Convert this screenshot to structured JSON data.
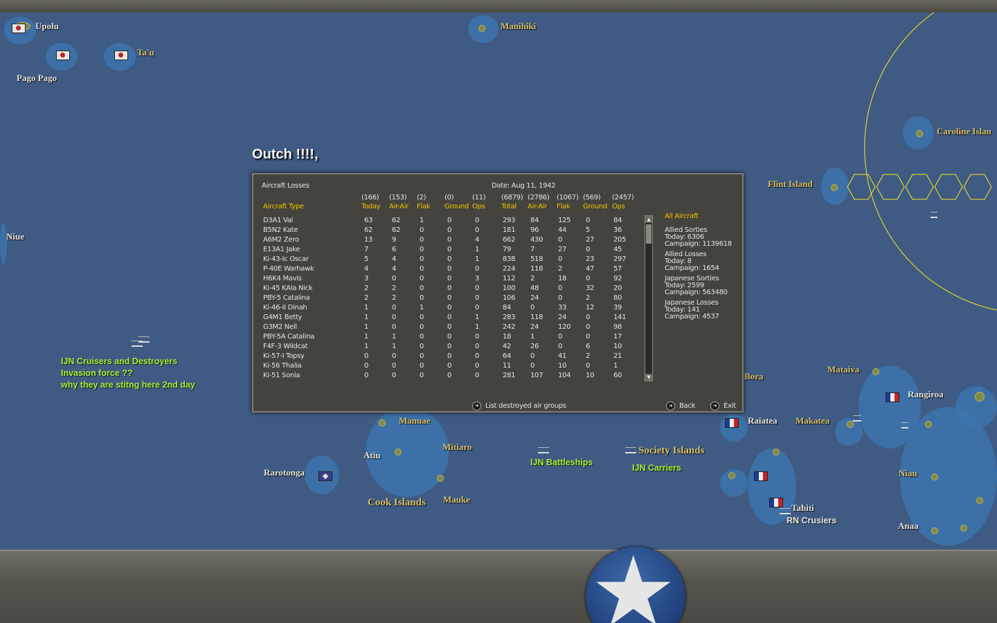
{
  "map": {
    "labels": {
      "upolu": "Upolu",
      "tau": "Ta'u",
      "pago_pago": "Pago Pago",
      "manihiki": "Manihiki",
      "caroline": "Caroline Islan",
      "flint": "Flint Island",
      "niue": "Niue",
      "bora": "Bora",
      "mataiva": "Mataiva",
      "rangiroa": "Rangiroa",
      "manuae": "Manuae",
      "raiatea": "Raiatea",
      "makatea": "Makatea",
      "mitiaro": "Mitiaro",
      "atiu": "Atiu",
      "society": "Society Islands",
      "niau": "Niau",
      "rarotonga": "Rarotonga",
      "cook": "Cook Islands",
      "mauke": "Mauke",
      "tahiti": "Tahiti",
      "anaa": "Anaa"
    },
    "annotations": {
      "cruisers_line1": "IJN Cruisers and Destroyers",
      "cruisers_line2": "Invasion force ??",
      "cruisers_line3": "why they are stitng here 2nd day",
      "battleships": "IJN Battleships",
      "carriers": "IJN Carriers",
      "rn_cruisers": "RN Crusiers"
    }
  },
  "title_text": "Outch !!!!,",
  "dialog": {
    "title": "Aircraft Losses",
    "date": "Date: Aug 11, 1942",
    "columns": [
      {
        "total": "",
        "label": "Aircraft Type"
      },
      {
        "total": "(166)",
        "label": "Today"
      },
      {
        "total": "(153)",
        "label": "Air-Air"
      },
      {
        "total": "(2)",
        "label": "Flak"
      },
      {
        "total": "(0)",
        "label": "Ground"
      },
      {
        "total": "(11)",
        "label": "Ops"
      },
      {
        "total": "(6879)",
        "label": "Total"
      },
      {
        "total": "(2786)",
        "label": "Air-Air"
      },
      {
        "total": "(1067)",
        "label": "Flak"
      },
      {
        "total": "(569)",
        "label": "Ground"
      },
      {
        "total": "(2457)",
        "label": "Ops"
      }
    ],
    "rows": [
      [
        "D3A1 Val",
        "63",
        "62",
        "1",
        "0",
        "0",
        "293",
        "84",
        "125",
        "0",
        "84"
      ],
      [
        "B5N2 Kate",
        "62",
        "62",
        "0",
        "0",
        "0",
        "181",
        "96",
        "44",
        "5",
        "36"
      ],
      [
        "A6M2 Zero",
        "13",
        "9",
        "0",
        "0",
        "4",
        "662",
        "430",
        "0",
        "27",
        "205"
      ],
      [
        "E13A1 Jake",
        "7",
        "6",
        "0",
        "0",
        "1",
        "79",
        "7",
        "27",
        "0",
        "45"
      ],
      [
        "Ki-43-Ic Oscar",
        "5",
        "4",
        "0",
        "0",
        "1",
        "838",
        "518",
        "0",
        "23",
        "297"
      ],
      [
        "P-40E Warhawk",
        "4",
        "4",
        "0",
        "0",
        "0",
        "224",
        "118",
        "2",
        "47",
        "57"
      ],
      [
        "H6K4 Mavis",
        "3",
        "0",
        "0",
        "0",
        "3",
        "112",
        "2",
        "18",
        "0",
        "92"
      ],
      [
        "Ki-45 KAIa Nick",
        "2",
        "2",
        "0",
        "0",
        "0",
        "100",
        "48",
        "0",
        "32",
        "20"
      ],
      [
        "PBY-5 Catalina",
        "2",
        "2",
        "0",
        "0",
        "0",
        "106",
        "24",
        "0",
        "2",
        "80"
      ],
      [
        "Ki-46-II Dinah",
        "1",
        "0",
        "1",
        "0",
        "0",
        "84",
        "0",
        "33",
        "12",
        "39"
      ],
      [
        "G4M1 Betty",
        "1",
        "0",
        "0",
        "0",
        "1",
        "283",
        "118",
        "24",
        "0",
        "141"
      ],
      [
        "G3M2 Nell",
        "1",
        "0",
        "0",
        "0",
        "1",
        "242",
        "24",
        "120",
        "0",
        "98"
      ],
      [
        "PBY-5A Catalina",
        "1",
        "1",
        "0",
        "0",
        "0",
        "18",
        "1",
        "0",
        "0",
        "17"
      ],
      [
        "F4F-3 Wildcat",
        "1",
        "1",
        "0",
        "0",
        "0",
        "42",
        "26",
        "0",
        "6",
        "10"
      ],
      [
        "Ki-57-I Topsy",
        "0",
        "0",
        "0",
        "0",
        "0",
        "64",
        "0",
        "41",
        "2",
        "21"
      ],
      [
        "Ki-56 Thalia",
        "0",
        "0",
        "0",
        "0",
        "0",
        "11",
        "0",
        "10",
        "0",
        "1"
      ],
      [
        "Ki-51 Sonia",
        "0",
        "0",
        "0",
        "0",
        "0",
        "281",
        "107",
        "104",
        "10",
        "60"
      ]
    ],
    "summary": {
      "all_aircraft": "All Aircraft",
      "allied_sorties": "Allied Sorties",
      "allied_sorties_today": "Today:  6306",
      "allied_sorties_campaign": "Campaign: 1139618",
      "allied_losses": "Allied Losses",
      "allied_losses_today": "Today:  8",
      "allied_losses_campaign": "Campaign: 1654",
      "japanese_sorties": "Japanese Sorties",
      "japanese_sorties_today": "Today:  2599",
      "japanese_sorties_campaign": "Campaign: 563480",
      "japanese_losses": "Japanese Losses",
      "japanese_losses_today": "Today:  141",
      "japanese_losses_campaign": "Campaign: 4537"
    },
    "buttons": {
      "list_groups": "List destroyed air groups",
      "back": "Back",
      "exit": "Exit"
    }
  },
  "colors": {
    "ocean": "#3f5b84",
    "shallow": "#3c74ad",
    "header_yellow": "#f1c400",
    "annotation_green": "#a6f03c",
    "hex_grid": "#f5ea1c"
  },
  "icons": [
    "star-roundel-icon",
    "japanese-flag-icon",
    "french-flag-icon",
    "ship-icon",
    "scroll-up-icon",
    "scroll-down-icon",
    "arrow-button-icon"
  ]
}
